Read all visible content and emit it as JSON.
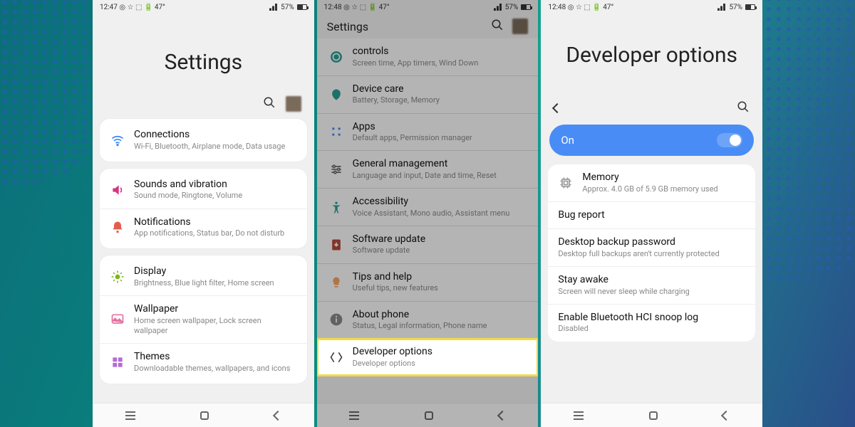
{
  "status": {
    "time1": "12:47",
    "time2": "12:48",
    "time3": "12:48",
    "icons_left": "◎ ☆ ⬚ 🔋 47°",
    "battery_pct": "57%"
  },
  "screen1": {
    "title": "Settings",
    "groups": [
      [
        {
          "icon": "wifi",
          "color": "#3a86ff",
          "title": "Connections",
          "sub": "Wi-Fi, Bluetooth, Airplane mode, Data usage"
        }
      ],
      [
        {
          "icon": "sound",
          "color": "#d63384",
          "title": "Sounds and vibration",
          "sub": "Sound mode, Ringtone, Volume"
        },
        {
          "icon": "bell",
          "color": "#e35d4d",
          "title": "Notifications",
          "sub": "App notifications, Status bar, Do not disturb"
        }
      ],
      [
        {
          "icon": "display",
          "color": "#7cb518",
          "title": "Display",
          "sub": "Brightness, Blue light filter, Home screen"
        },
        {
          "icon": "wallpaper",
          "color": "#e573a0",
          "title": "Wallpaper",
          "sub": "Home screen wallpaper, Lock screen wallpaper"
        },
        {
          "icon": "themes",
          "color": "#b56bd6",
          "title": "Themes",
          "sub": "Downloadable themes, wallpapers, and icons"
        }
      ]
    ]
  },
  "screen2": {
    "header": "Settings",
    "items": [
      {
        "icon": "wellbeing",
        "color": "#2a9d8f",
        "title": "controls",
        "sub": "Screen time, App timers, Wind Down"
      },
      {
        "icon": "devicecare",
        "color": "#2a9d8f",
        "title": "Device care",
        "sub": "Battery, Storage, Memory"
      },
      {
        "icon": "apps",
        "color": "#4a8cf5",
        "title": "Apps",
        "sub": "Default apps, Permission manager"
      }
    ],
    "items2": [
      {
        "icon": "general",
        "color": "#666",
        "title": "General management",
        "sub": "Language and input, Date and time, Reset"
      },
      {
        "icon": "access",
        "color": "#2a9d8f",
        "title": "Accessibility",
        "sub": "Voice Assistant, Mono audio, Assistant menu"
      }
    ],
    "items3": [
      {
        "icon": "update",
        "color": "#b5483a",
        "title": "Software update",
        "sub": "Software update"
      },
      {
        "icon": "tips",
        "color": "#f4a261",
        "title": "Tips and help",
        "sub": "Useful tips, new features"
      },
      {
        "icon": "about",
        "color": "#888",
        "title": "About phone",
        "sub": "Status, Legal information, Phone name"
      }
    ],
    "highlight": {
      "icon": "code",
      "title": "Developer options",
      "sub": "Developer options"
    }
  },
  "screen3": {
    "title": "Developer options",
    "on_label": "On",
    "items": [
      {
        "icon": "memory",
        "title": "Memory",
        "sub": "Approx. 4.0 GB of 5.9 GB memory used"
      },
      {
        "title": "Bug report"
      },
      {
        "title": "Desktop backup password",
        "sub": "Desktop full backups aren't currently protected"
      },
      {
        "title": "Stay awake",
        "sub": "Screen will never sleep while charging",
        "toggle": false
      },
      {
        "title": "Enable Bluetooth HCI snoop log",
        "sub": "Disabled"
      }
    ]
  }
}
